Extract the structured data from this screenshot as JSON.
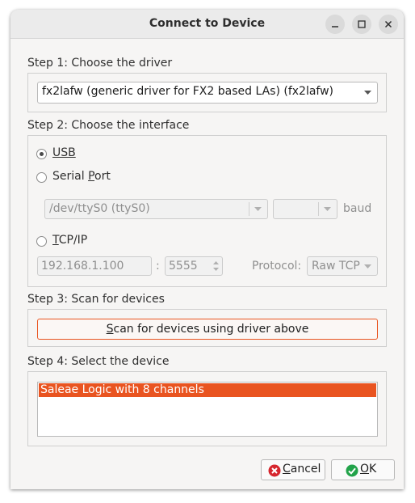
{
  "window": {
    "title": "Connect to Device"
  },
  "step1": {
    "label": "Step 1: Choose the driver",
    "driver_selected": "fx2lafw (generic driver for FX2 based LAs) (fx2lafw)"
  },
  "step2": {
    "label": "Step 2: Choose the interface",
    "usb_label": "USB",
    "usb_checked": true,
    "serial_label_prefix": "Serial ",
    "serial_label_mnemonic": "P",
    "serial_label_suffix": "ort",
    "serial_port_value": "/dev/ttyS0 (ttyS0)",
    "baud_value": "",
    "baud_label": "baud",
    "tcp_label_prefix": "",
    "tcp_label_mnemonic": "T",
    "tcp_label_suffix": "CP/IP",
    "host_value": "192.168.1.100",
    "host_port_separator": ":",
    "port_value": "5555",
    "protocol_label": "Protocol:",
    "protocol_value": "Raw TCP"
  },
  "step3": {
    "label": "Step 3: Scan for devices",
    "scan_mnemonic": "S",
    "scan_rest": "can for devices using driver above"
  },
  "step4": {
    "label": "Step 4: Select the device",
    "devices": [
      "Saleae Logic with 8 channels"
    ]
  },
  "buttons": {
    "cancel_mnemonic": "C",
    "cancel_rest": "ancel",
    "ok_mnemonic": "O",
    "ok_rest": "K"
  },
  "colors": {
    "accent": "#e95420",
    "cancel_icon": "#d6262e",
    "ok_icon": "#22a34a"
  },
  "icons": {
    "minimize": "minimize-icon",
    "maximize": "maximize-icon",
    "close": "close-icon",
    "cancel": "cancel-icon",
    "ok": "check-icon"
  }
}
